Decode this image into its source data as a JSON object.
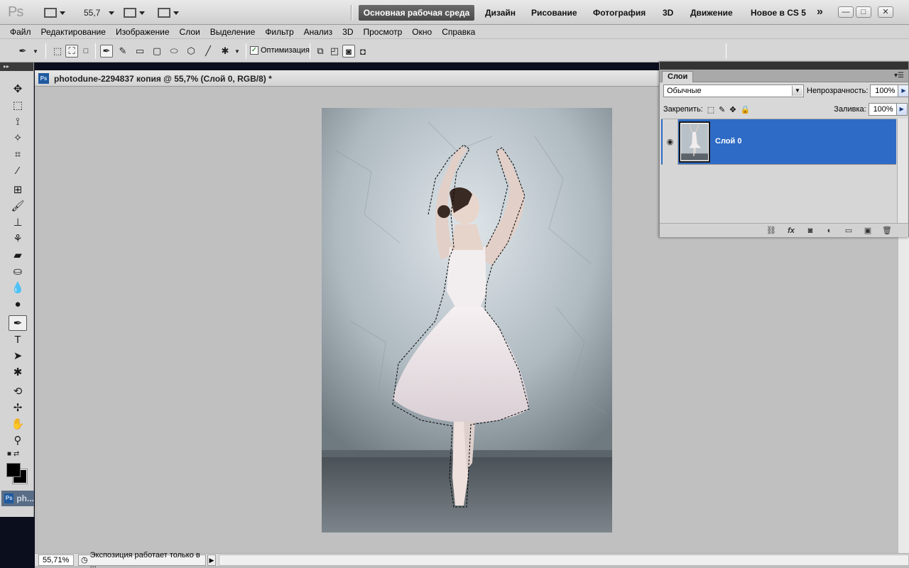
{
  "appbar": {
    "logo": "Ps",
    "zoom_value": "55,7",
    "workspaces": [
      "Основная рабочая среда",
      "Дизайн",
      "Рисование",
      "Фотография",
      "3D",
      "Движение",
      "Новое в CS 5"
    ],
    "more": "»",
    "window_buttons": [
      "—",
      "□",
      "✕"
    ]
  },
  "menu": [
    "Файл",
    "Редактирование",
    "Изображение",
    "Слои",
    "Выделение",
    "Фильтр",
    "Анализ",
    "3D",
    "Просмотр",
    "Окно",
    "Справка"
  ],
  "options": {
    "optimization_label": "Оптимизация",
    "optimization_checked": true
  },
  "document": {
    "tab_icon": "Ps",
    "title": "photodune-2294837 копия @ 55,7% (Слой 0, RGB/8) *"
  },
  "mini_doc": {
    "icon": "Ps",
    "label": "ph..."
  },
  "status": {
    "zoom": "55,71%",
    "info": "Экспозиция работает только в ..."
  },
  "layers_panel": {
    "tab": "Слои",
    "blend_mode": "Обычные",
    "opacity_label": "Непрозрачность:",
    "opacity": "100%",
    "lock_label": "Закрепить:",
    "fill_label": "Заливка:",
    "fill": "100%",
    "layers": [
      {
        "name": "Слой 0",
        "visible": true,
        "selected": true
      }
    ]
  },
  "colors": {
    "selected_layer": "#2e6bc6",
    "foreground": "#000000",
    "background": "#000000",
    "canvas_bg": "#c0c0c0"
  },
  "icons": {
    "tools": [
      "move-icon",
      "marquee-icon",
      "lasso-icon",
      "quick-select-icon",
      "crop-icon",
      "eyedropper-icon",
      "healing-brush-icon",
      "brush-icon",
      "clone-stamp-icon",
      "history-brush-icon",
      "eraser-icon",
      "paint-bucket-icon",
      "blur-icon",
      "dodge-icon",
      "pen-icon",
      "type-icon",
      "path-select-icon",
      "custom-shape-icon",
      "3d-rotate-icon",
      "3d-orbit-icon",
      "hand-icon",
      "zoom-icon"
    ],
    "layer_footer": [
      "link-icon",
      "fx-icon",
      "mask-icon",
      "adjustment-icon",
      "group-icon",
      "new-layer-icon",
      "trash-icon"
    ]
  }
}
